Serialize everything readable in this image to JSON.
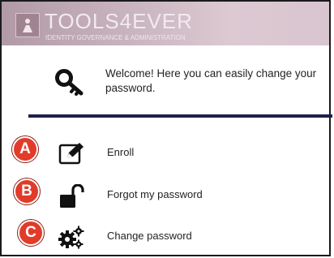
{
  "header": {
    "title": "TOOLS4EVER",
    "subtitle": "IDENTITY GOVERNANCE & ADMINISTRATION",
    "bg_color": "#c4aeb8"
  },
  "welcome": {
    "icon": "key-icon",
    "text": "Welcome! Here you can easily change your password."
  },
  "menu": [
    {
      "badge": "A",
      "icon": "edit-icon",
      "label": "Enroll"
    },
    {
      "badge": "B",
      "icon": "unlock-icon",
      "label": "Forgot my password"
    },
    {
      "badge": "C",
      "icon": "gears-icon",
      "label": "Change password"
    }
  ],
  "colors": {
    "badge": "#e23b2a",
    "divider": "#1f1f4d",
    "icon": "#111111"
  }
}
